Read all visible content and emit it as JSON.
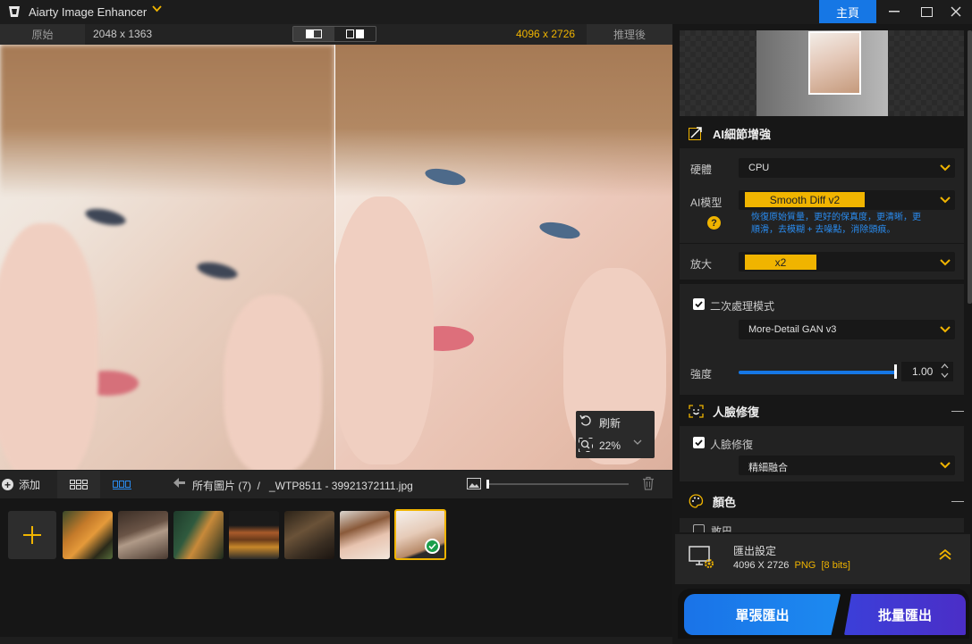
{
  "titlebar": {
    "app_title": "Aiarty Image Enhancer",
    "home_label": "主頁"
  },
  "compare": {
    "original_label": "原始",
    "original_size": "2048 x 1363",
    "output_size": "4096 x 2726",
    "after_label": "推理後"
  },
  "zoom": {
    "refresh_label": "刷新",
    "zoom_value": "22%"
  },
  "bottom": {
    "add_label": "添加",
    "breadcrumb": "所有圖片 (7)  /   _WTP8511 - 39921372111.jpg"
  },
  "right": {
    "ai_section": "AI細節增強",
    "hardware_label": "硬體",
    "hardware_value": "CPU",
    "model_label": "AI模型",
    "model_value": "Smooth Diff  v2",
    "model_desc": "恢復原始質量，更好的保真度，更清晰，更順滑，去模糊 + 去噪點，消除頭痕。",
    "scale_label": "放大",
    "scale_value": "x2",
    "second_pass_label": "二次處理模式",
    "second_pass_model": "More-Detail GAN  v3",
    "strength_label": "強度",
    "strength_value": "1.00",
    "face_section": "人臉修復",
    "face_check_label": "人臉修復",
    "face_mode": "精細融合",
    "color_section": "顏色",
    "color_partial": "敢巴"
  },
  "export": {
    "title": "匯出設定",
    "dims": "4096 X 2726",
    "format": "PNG",
    "bits": "[8 bits]",
    "single_label": "單張匯出",
    "batch_label": "批量匯出"
  },
  "colors": {
    "accent_yellow": "#f0b400",
    "accent_blue": "#1677e5",
    "batch_purple": "#3b3fd9"
  }
}
